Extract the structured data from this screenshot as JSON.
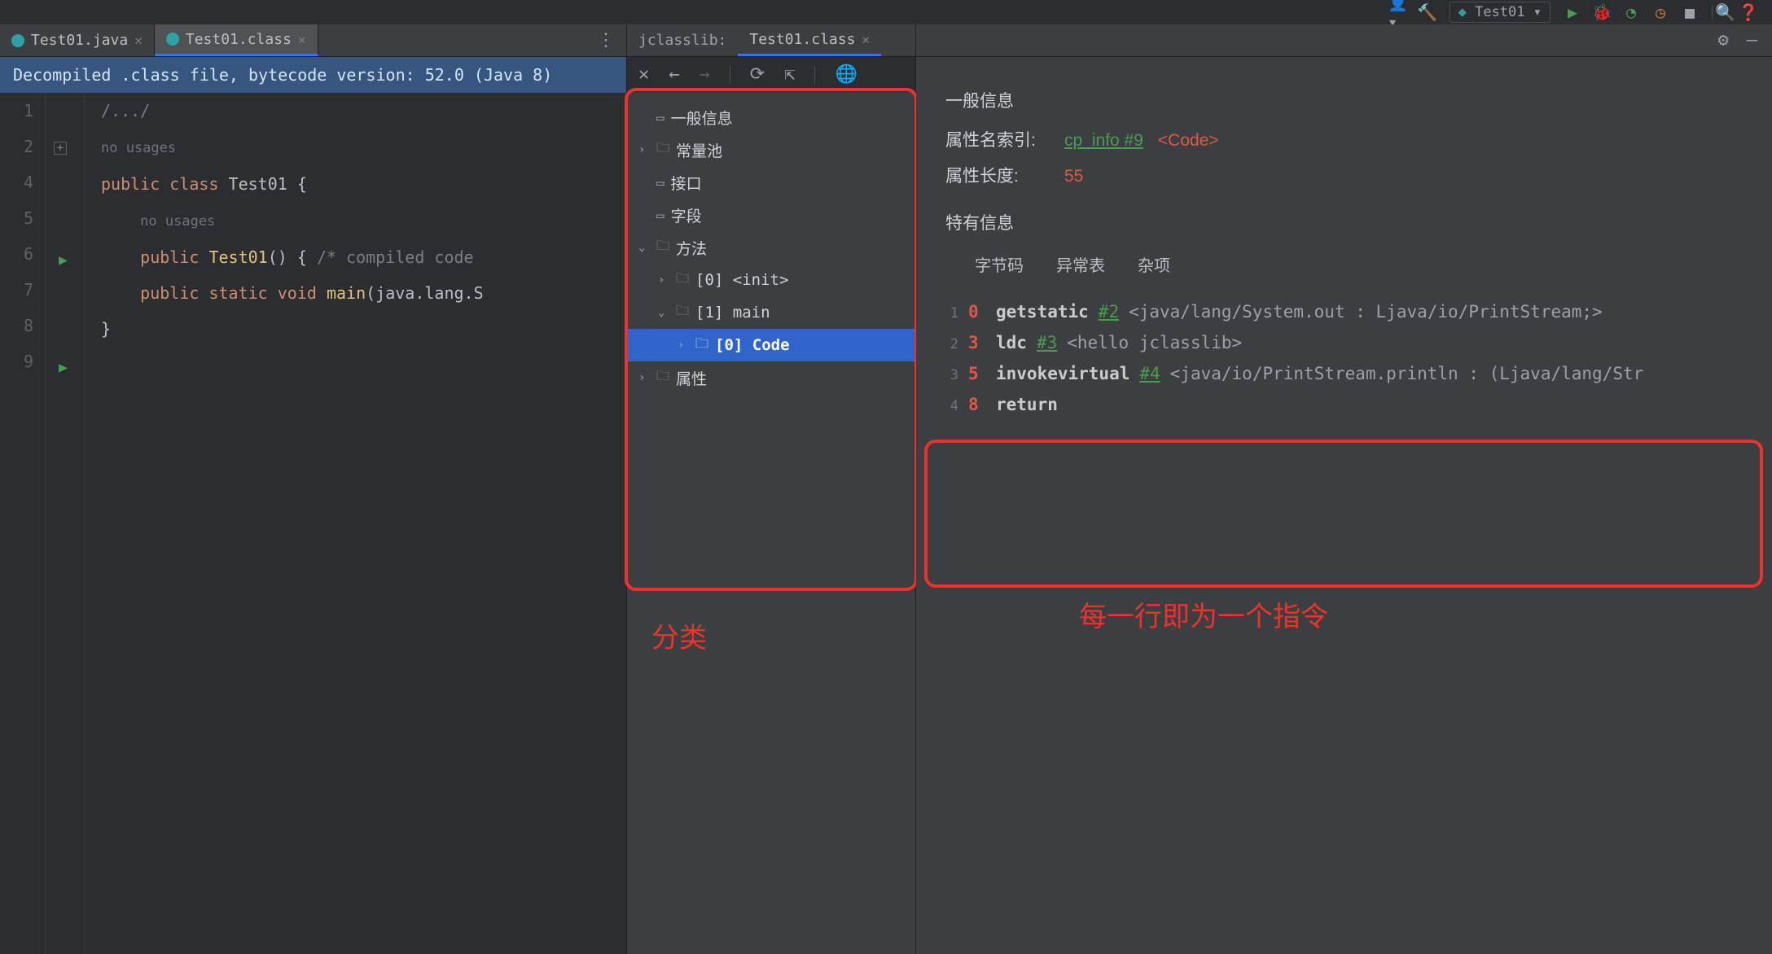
{
  "toolbar": {
    "config_name": "Test01",
    "icons": [
      "person-icon",
      "hammer-icon",
      "play-icon",
      "bug-icon",
      "coverage-icon",
      "profile-icon",
      "stop-icon",
      "search-icon",
      "help-icon"
    ]
  },
  "editor": {
    "tabs": [
      {
        "label": "Test01.java",
        "active": false
      },
      {
        "label": "Test01.class",
        "active": true
      }
    ],
    "banner": "Decompiled .class file, bytecode version: 52.0 (Java 8)",
    "gutter_lines": [
      "1",
      "2",
      "4",
      "",
      "5",
      "",
      "6",
      "7",
      "8",
      "9"
    ],
    "run_marks": [
      5,
      8
    ],
    "code_lines": [
      {
        "t": "plain",
        "text": ""
      },
      {
        "t": "comment",
        "text": "/.../"
      },
      {
        "t": "plain",
        "text": ""
      },
      {
        "t": "hint",
        "text": "no usages"
      },
      {
        "t": "classdecl",
        "kw": "public class",
        "name": "Test01",
        "brace": " {"
      },
      {
        "t": "hint_in",
        "text": "no usages"
      },
      {
        "t": "ctor",
        "kw": "public",
        "name": "Test01",
        "rest": "() { ",
        "comment": "/* compiled code"
      },
      {
        "t": "plain",
        "text": ""
      },
      {
        "t": "method",
        "kw": "public static void",
        "name": "main",
        "rest": "(java.lang.S"
      },
      {
        "t": "close",
        "text": "}"
      }
    ]
  },
  "jclasslib": {
    "header_label": "jclasslib:",
    "tab": "Test01.class",
    "toolbar_icons": [
      "close-icon",
      "back-icon",
      "forward-icon",
      "refresh-icon",
      "export-icon",
      "globe-icon"
    ],
    "tree": [
      {
        "icon": "page",
        "label": "一般信息",
        "depth": 0,
        "chev": ""
      },
      {
        "icon": "folder",
        "label": "常量池",
        "depth": 0,
        "chev": ">"
      },
      {
        "icon": "page",
        "label": "接口",
        "depth": 0,
        "chev": ""
      },
      {
        "icon": "page",
        "label": "字段",
        "depth": 0,
        "chev": ""
      },
      {
        "icon": "folder",
        "label": "方法",
        "depth": 0,
        "chev": "v"
      },
      {
        "icon": "folder",
        "label": "[0] <init>",
        "depth": 1,
        "chev": ">"
      },
      {
        "icon": "folder",
        "label": "[1] main",
        "depth": 1,
        "chev": "v"
      },
      {
        "icon": "folder",
        "label": "[0] Code",
        "depth": 2,
        "chev": ">",
        "selected": true,
        "bold": true
      },
      {
        "icon": "folder",
        "label": "属性",
        "depth": 0,
        "chev": ">"
      }
    ]
  },
  "detail": {
    "section_general": "一般信息",
    "attr_name_label": "属性名索引:",
    "attr_name_link": "cp_info #9",
    "attr_name_tag": "<Code>",
    "attr_len_label": "属性长度:",
    "attr_len_value": "55",
    "section_special": "特有信息",
    "tabs": [
      "字节码",
      "异常表",
      "杂项"
    ],
    "bytecode": [
      {
        "g": "1",
        "off": "0",
        "op": "getstatic",
        "ref": "#2",
        "desc": "<java/lang/System.out : Ljava/io/PrintStream;>"
      },
      {
        "g": "2",
        "off": "3",
        "op": "ldc",
        "ref": "#3",
        "desc": "<hello jclasslib>"
      },
      {
        "g": "3",
        "off": "5",
        "op": "invokevirtual",
        "ref": "#4",
        "desc": "<java/io/PrintStream.println : (Ljava/lang/Str"
      },
      {
        "g": "4",
        "off": "8",
        "op": "return",
        "ref": "",
        "desc": ""
      }
    ]
  },
  "annotations": {
    "tree_label": "分类",
    "bytecode_label": "每一行即为一个指令"
  }
}
